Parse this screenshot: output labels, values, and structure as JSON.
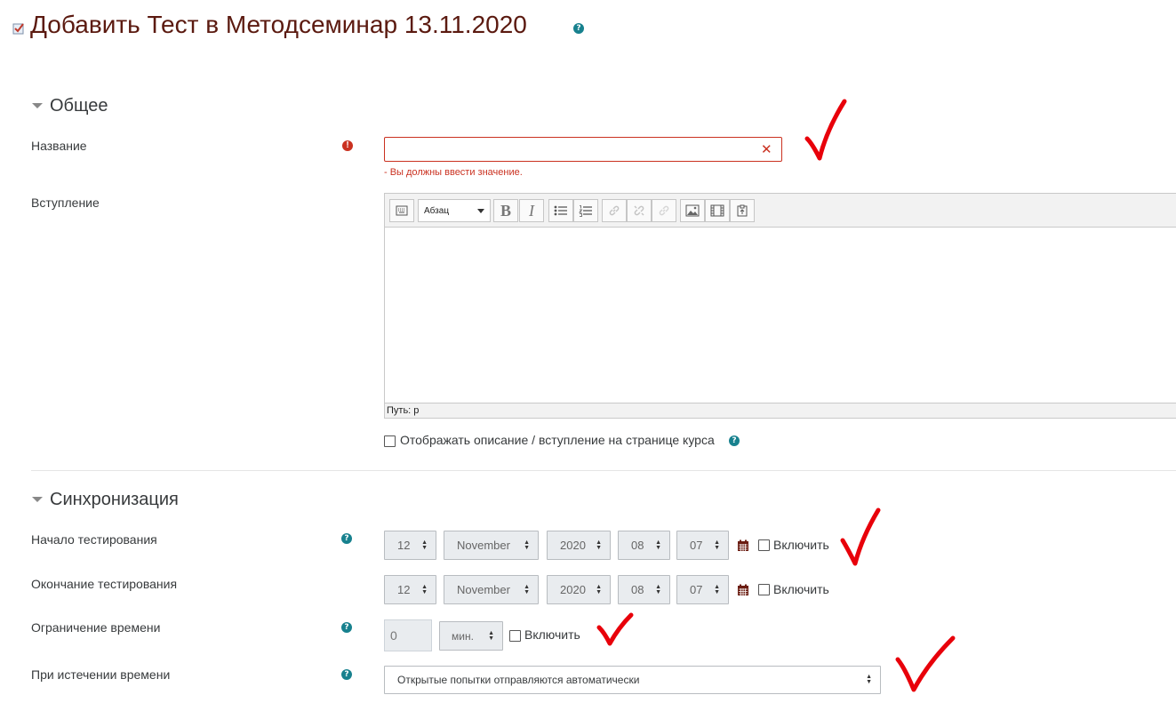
{
  "page": {
    "title": "Добавить Тест в Методсеминар 13.11.2020"
  },
  "general": {
    "heading": "Общее",
    "name_label": "Название",
    "name_value": "",
    "name_error": "- Вы должны ввести значение.",
    "intro_label": "Вступление",
    "editor": {
      "format_select": "Абзац",
      "bold": "B",
      "italic": "I",
      "path": "Путь: p"
    },
    "show_description_label": "Отображать описание / вступление на странице курса"
  },
  "timing": {
    "heading": "Синхронизация",
    "open_label": "Начало тестирования",
    "close_label": "Окончание тестирования",
    "open": {
      "day": "12",
      "month": "November",
      "year": "2020",
      "hour": "08",
      "minute": "07",
      "enable_label": "Включить"
    },
    "close": {
      "day": "12",
      "month": "November",
      "year": "2020",
      "hour": "08",
      "minute": "07",
      "enable_label": "Включить"
    },
    "limit_label": "Ограничение времени",
    "limit_value": "0",
    "limit_unit": "мин.",
    "limit_enable_label": "Включить",
    "overdue_label": "При истечении времени",
    "overdue_value": "Открытые попытки отправляются автоматически"
  },
  "colors": {
    "title": "#5b1a10",
    "error": "#ca3120",
    "help": "#17818e",
    "annotation": "#e8000a"
  }
}
